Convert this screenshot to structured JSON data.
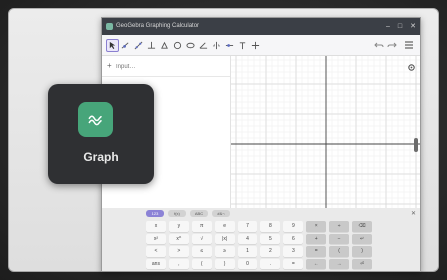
{
  "window": {
    "title": "GeoGebra Graphing Calculator",
    "controls": [
      "–",
      "□",
      "✕"
    ]
  },
  "toolbar": {
    "tools": [
      "move-icon",
      "point-icon",
      "line-icon",
      "perpendicular-icon",
      "polygon-icon",
      "circle-icon",
      "ellipse-icon",
      "angle-icon",
      "reflect-icon",
      "slider-icon",
      "text-icon",
      "move-view-icon"
    ],
    "right": [
      "undo-icon",
      "redo-icon",
      "menu-icon"
    ]
  },
  "algebra": {
    "input_placeholder": "Input…",
    "plus": "+"
  },
  "keyboard": {
    "tabs": [
      "123",
      "f(x)",
      "ABC",
      "#&¬"
    ],
    "close": "✕",
    "keys": [
      "x",
      "y",
      "π",
      "e",
      "7",
      "8",
      "9",
      "×",
      "÷",
      "⌫",
      "x²",
      "x^",
      "√",
      "|x|",
      "4",
      "5",
      "6",
      "+",
      "−",
      "↵",
      "<",
      ">",
      "≤",
      "≥",
      "1",
      "2",
      "3",
      "=",
      "(",
      ")",
      "ans",
      ",",
      "(",
      ")",
      "0",
      ".",
      "=",
      "←",
      "→",
      "⏎"
    ]
  },
  "app_tile": {
    "label": "Graph",
    "icon": "graph-wave-icon",
    "icon_color": "#47a57a"
  },
  "colors": {
    "accent": "#8c83d6",
    "titlebar": "#3b3f46"
  }
}
